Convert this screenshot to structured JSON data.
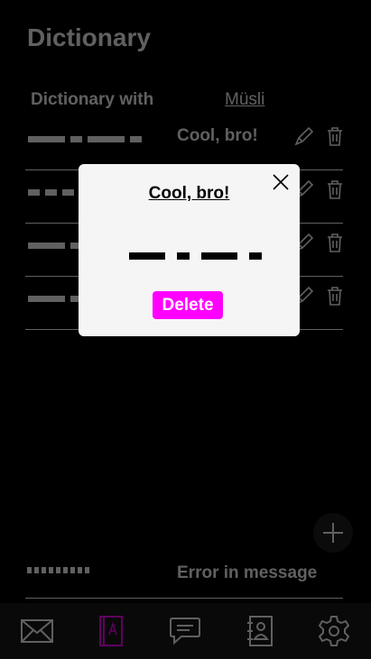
{
  "app": {
    "title": "Dictionary"
  },
  "header": {
    "left_label": "Dictionary with",
    "right_link": "Müsli"
  },
  "rows": [
    {
      "word": "Cool, bro!"
    },
    {
      "word": ""
    },
    {
      "word": ""
    },
    {
      "word": ""
    }
  ],
  "status": {
    "error_text": "Error in message"
  },
  "dialog": {
    "title": "Cool, bro!",
    "code_symbols": [
      "dash",
      "dot",
      "dash",
      "dot"
    ],
    "delete_label": "Delete"
  },
  "nav": {
    "items": [
      {
        "icon": "envelope-icon",
        "active": false
      },
      {
        "icon": "dictionary-icon",
        "active": true
      },
      {
        "icon": "chat-icon",
        "active": false
      },
      {
        "icon": "contacts-icon",
        "active": false
      },
      {
        "icon": "settings-icon",
        "active": false
      }
    ]
  },
  "colors": {
    "accent": "#ff00ff",
    "background": "#000000",
    "dialog_bg": "#f5f5f5",
    "navbar_bg": "#1a1a1a"
  }
}
